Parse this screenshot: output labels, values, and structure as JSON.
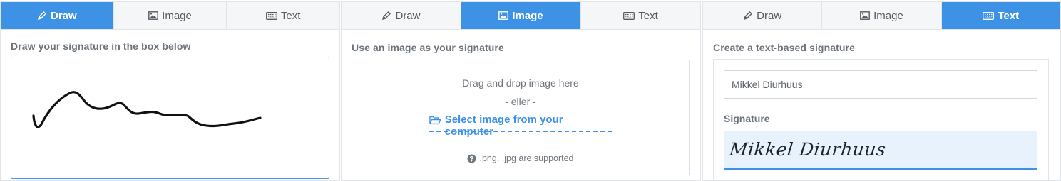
{
  "colors": {
    "accent": "#3d92e6",
    "tab_inactive_bg": "#f5f6f7",
    "border": "#e1e4e8",
    "muted_text": "#6c737c"
  },
  "tabs": [
    {
      "label": "Draw",
      "icon": "pen-icon"
    },
    {
      "label": "Image",
      "icon": "image-icon"
    },
    {
      "label": "Text",
      "icon": "keyboard-icon"
    }
  ],
  "draw_panel": {
    "active_tab": "Draw",
    "heading": "Draw your signature in the box below"
  },
  "image_panel": {
    "active_tab": "Image",
    "heading": "Use an image as your signature",
    "drop_text": "Drag and drop image here",
    "or_text": "- eller -",
    "select_link": "Select image from your computer",
    "select_icon": "folder-open-icon",
    "supported_text": ".png, .jpg are supported",
    "supported_icon": "question-circle-icon"
  },
  "text_panel": {
    "active_tab": "Text",
    "heading": "Create a text-based signature",
    "name_value": "Mikkel Diurhuus",
    "signature_label": "Signature",
    "signature_preview": "Mikkel Diurhuus"
  }
}
